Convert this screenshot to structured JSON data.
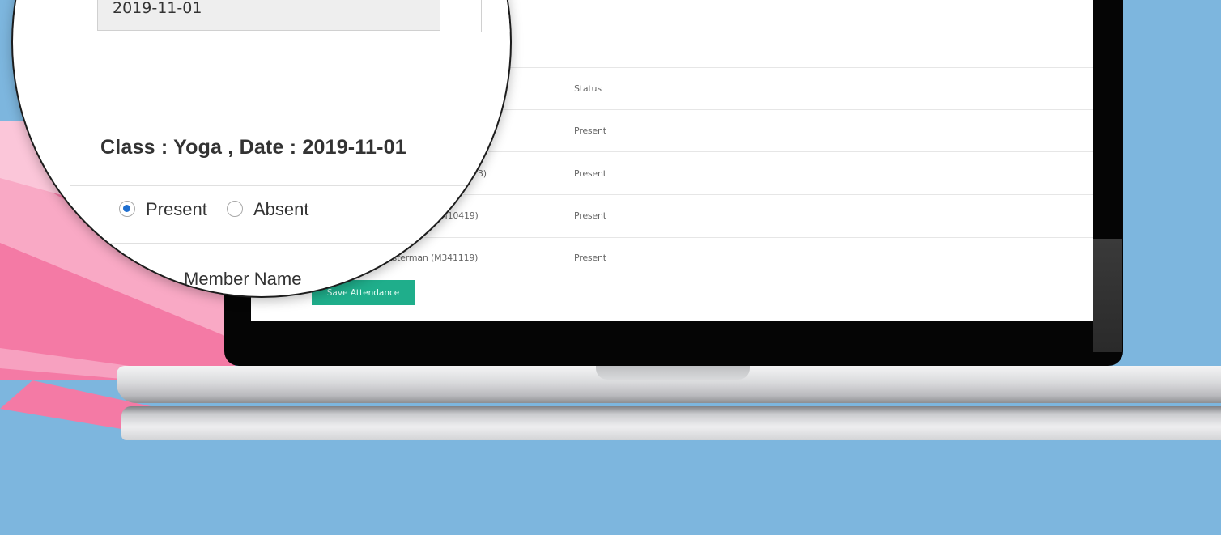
{
  "magnifier": {
    "date_value": "2019-11-01",
    "class_heading": "Class : Yoga , Date : 2019-11-01",
    "radio_present_label": "Present",
    "radio_absent_label": "Absent",
    "selected_option": "Present",
    "member_name_header": "Member Name"
  },
  "table": {
    "status_header": "Status",
    "rows": [
      {
        "member": "",
        "status": "Present"
      },
      {
        "member": "3)",
        "status": "Present"
      },
      {
        "member": "er (M10419)",
        "status": "Present"
      },
      {
        "member": "asterman (M341119)",
        "status": "Present"
      }
    ]
  },
  "actions": {
    "save_label": "Save Attendance"
  },
  "colors": {
    "background": "#7db6de",
    "accent_button": "#1fae8b",
    "pink_decor": "#f47aa5",
    "radio_selected": "#1f6fd0"
  }
}
